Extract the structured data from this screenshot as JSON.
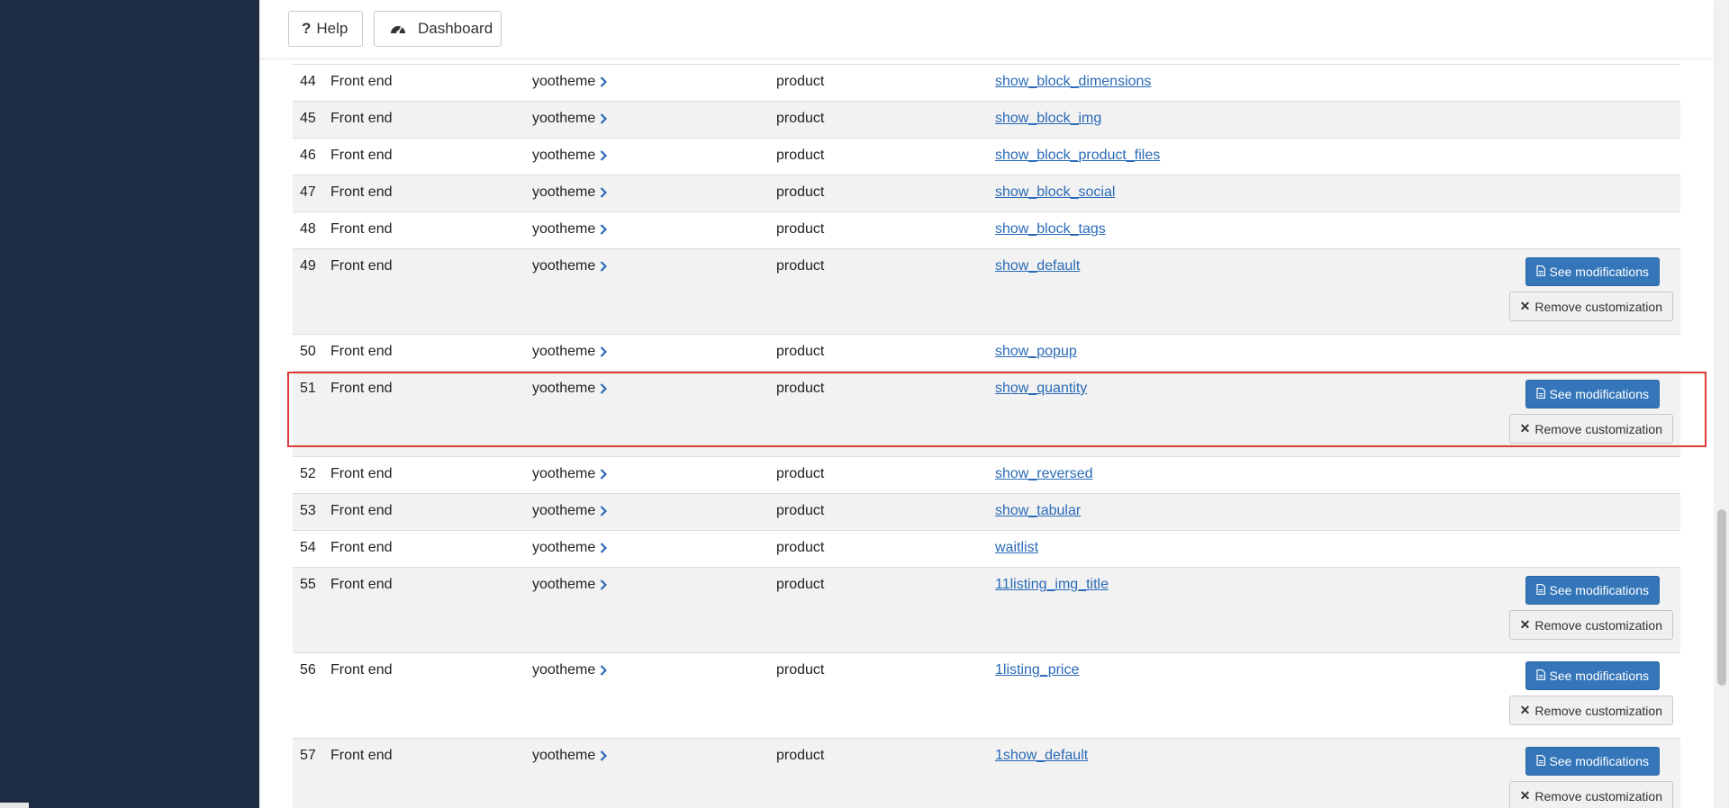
{
  "toolbar": {
    "help_label": "Help",
    "dashboard_label": "Dashboard"
  },
  "rows": [
    {
      "num": "44",
      "location": "Front end",
      "template": "yootheme",
      "view": "product",
      "file": "show_block_dimensions",
      "customized": false
    },
    {
      "num": "45",
      "location": "Front end",
      "template": "yootheme",
      "view": "product",
      "file": "show_block_img",
      "customized": false
    },
    {
      "num": "46",
      "location": "Front end",
      "template": "yootheme",
      "view": "product",
      "file": "show_block_product_files",
      "customized": false
    },
    {
      "num": "47",
      "location": "Front end",
      "template": "yootheme",
      "view": "product",
      "file": "show_block_social",
      "customized": false
    },
    {
      "num": "48",
      "location": "Front end",
      "template": "yootheme",
      "view": "product",
      "file": "show_block_tags",
      "customized": false
    },
    {
      "num": "49",
      "location": "Front end",
      "template": "yootheme",
      "view": "product",
      "file": "show_default",
      "customized": true
    },
    {
      "num": "50",
      "location": "Front end",
      "template": "yootheme",
      "view": "product",
      "file": "show_popup",
      "customized": false
    },
    {
      "num": "51",
      "location": "Front end",
      "template": "yootheme",
      "view": "product",
      "file": "show_quantity",
      "customized": true
    },
    {
      "num": "52",
      "location": "Front end",
      "template": "yootheme",
      "view": "product",
      "file": "show_reversed",
      "customized": false
    },
    {
      "num": "53",
      "location": "Front end",
      "template": "yootheme",
      "view": "product",
      "file": "show_tabular",
      "customized": false
    },
    {
      "num": "54",
      "location": "Front end",
      "template": "yootheme",
      "view": "product",
      "file": "waitlist",
      "customized": false
    },
    {
      "num": "55",
      "location": "Front end",
      "template": "yootheme",
      "view": "product",
      "file": "11listing_img_title",
      "customized": true
    },
    {
      "num": "56",
      "location": "Front end",
      "template": "yootheme",
      "view": "product",
      "file": "1listing_price",
      "customized": true
    },
    {
      "num": "57",
      "location": "Front end",
      "template": "yootheme",
      "view": "product",
      "file": "1show_default",
      "customized": true
    }
  ],
  "buttons": {
    "see_modifications": "See modifications",
    "remove_customization": "Remove customization"
  },
  "icons": {
    "help": "question-icon",
    "dashboard": "speedometer-icon",
    "see": "file-icon",
    "remove": "close-icon",
    "template_link": "chevron-right-icon"
  },
  "colors": {
    "sidebar": "#1f2d44",
    "primary_button": "#3476b9",
    "link": "#2a6ab7",
    "highlight": "#e03a3a",
    "row_alt": "#f2f2f2"
  }
}
